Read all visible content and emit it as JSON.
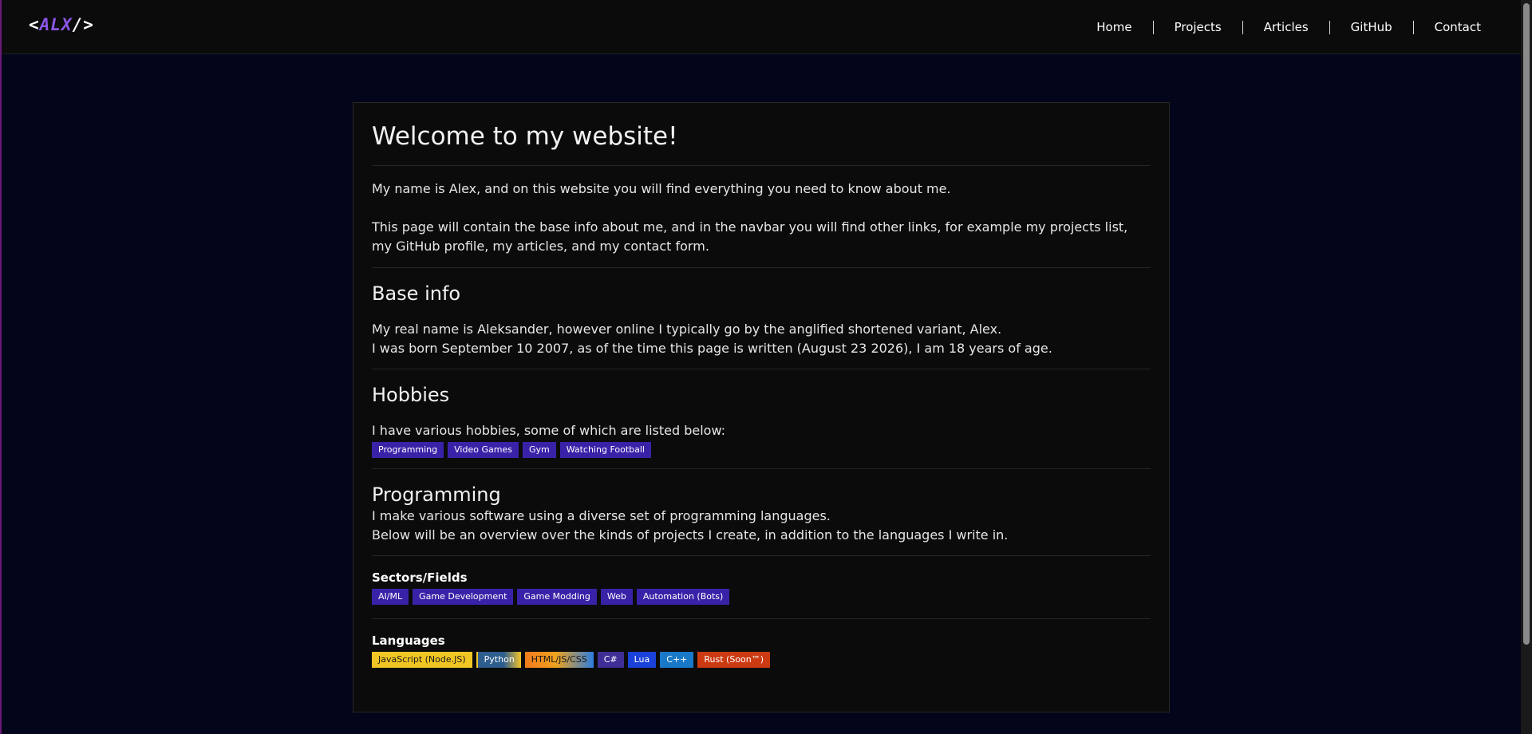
{
  "nav": {
    "logo": {
      "open": "<",
      "text": "ALX",
      "close": "/>"
    },
    "links": [
      "Home",
      "Projects",
      "Articles",
      "GitHub",
      "Contact"
    ]
  },
  "main": {
    "title": "Welcome to my website!",
    "intro": [
      "My name is Alex, and on this website you will find everything you need to know about me.",
      "This page will contain the base info about me, and in the navbar you will find other links, for example my projects list, my GitHub profile, my articles, and my contact form."
    ],
    "base_info": {
      "heading": "Base info",
      "lines": [
        "My real name is Aleksander, however online I typically go by the anglified shortened variant, Alex.",
        "I was born September 10 2007, as of the time this page is written (August 23 2026), I am 18 years of age."
      ]
    },
    "hobbies": {
      "heading": "Hobbies",
      "text": "I have various hobbies, some of which are listed below:",
      "tags": [
        "Programming",
        "Video Games",
        "Gym",
        "Watching Football"
      ]
    },
    "programming": {
      "heading": "Programming",
      "lines": [
        "I make various software using a diverse set of programming languages.",
        "Below will be an overview over the kinds of projects I create, in addition to the languages I write in."
      ]
    },
    "sectors": {
      "heading": "Sectors/Fields",
      "tags": [
        "AI/ML",
        "Game Development",
        "Game Modding",
        "Web",
        "Automation (Bots)"
      ]
    },
    "languages": {
      "heading": "Languages",
      "tags": [
        "JavaScript (Node.JS)",
        "Python",
        "HTML/JS/CSS",
        "C#",
        "Lua",
        "C++",
        "Rust (Soon™)"
      ]
    }
  },
  "colors": {
    "background": "#03061a",
    "card": "#0b0b0b",
    "tag": "#3a22a8",
    "logo_accent": "#8d56e8"
  }
}
